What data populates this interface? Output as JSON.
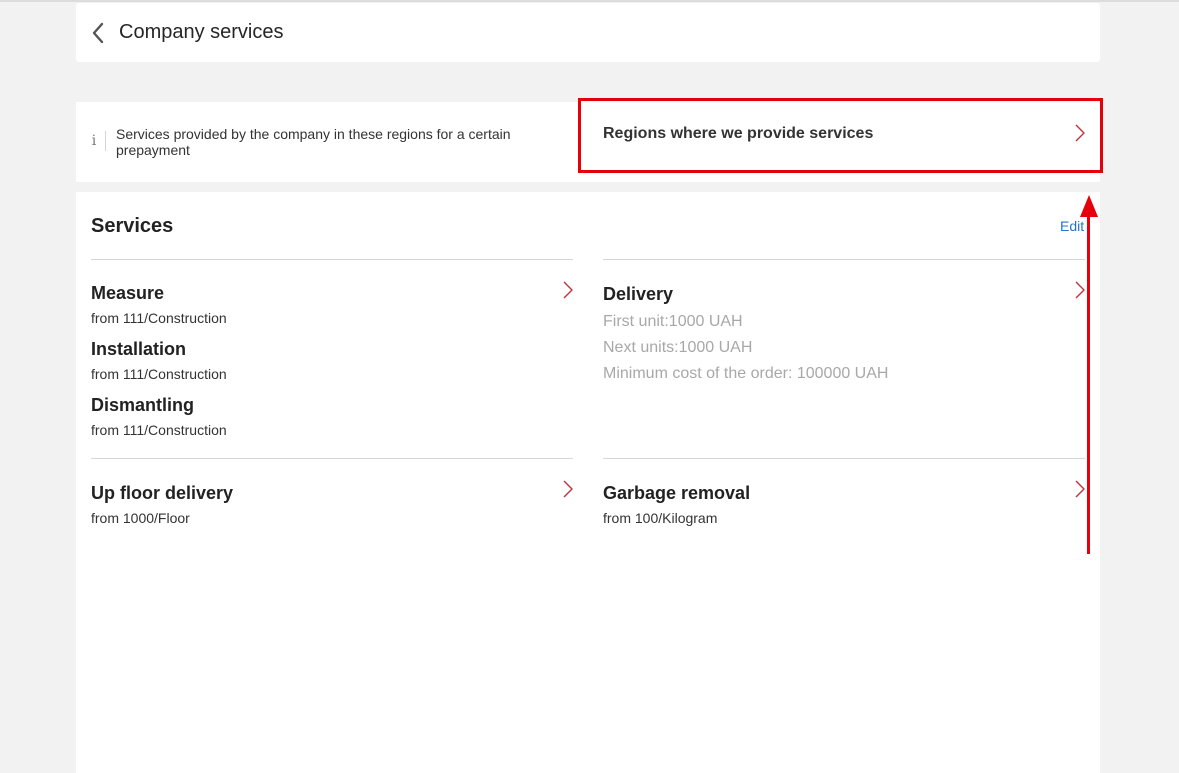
{
  "header": {
    "title": "Company services"
  },
  "info": {
    "icon": "info-icon",
    "text": "Services provided by the company in these regions for a certain prepayment",
    "regions_label": "Regions where we provide services"
  },
  "services": {
    "title": "Services",
    "edit_label": "Edit",
    "left_group": [
      {
        "name": "Measure",
        "price": "from 111/Construction"
      },
      {
        "name": "Installation",
        "price": "from 111/Construction"
      },
      {
        "name": "Dismantling",
        "price": "from 111/Construction"
      }
    ],
    "delivery": {
      "name": "Delivery",
      "first_unit": "First unit:1000 UAH",
      "next_units": "Next units:1000 UAH",
      "minimum": "Minimum cost of the order: 100000 UAH"
    },
    "up_floor": {
      "name": "Up floor delivery",
      "price": "from 1000/Floor"
    },
    "garbage": {
      "name": "Garbage removal",
      "price": "from 100/Kilogram"
    }
  },
  "colors": {
    "accent_red": "#e6000a",
    "chevron": "#c1303c",
    "link_blue": "#2a72c9",
    "muted_grey": "#a8a8a8"
  }
}
